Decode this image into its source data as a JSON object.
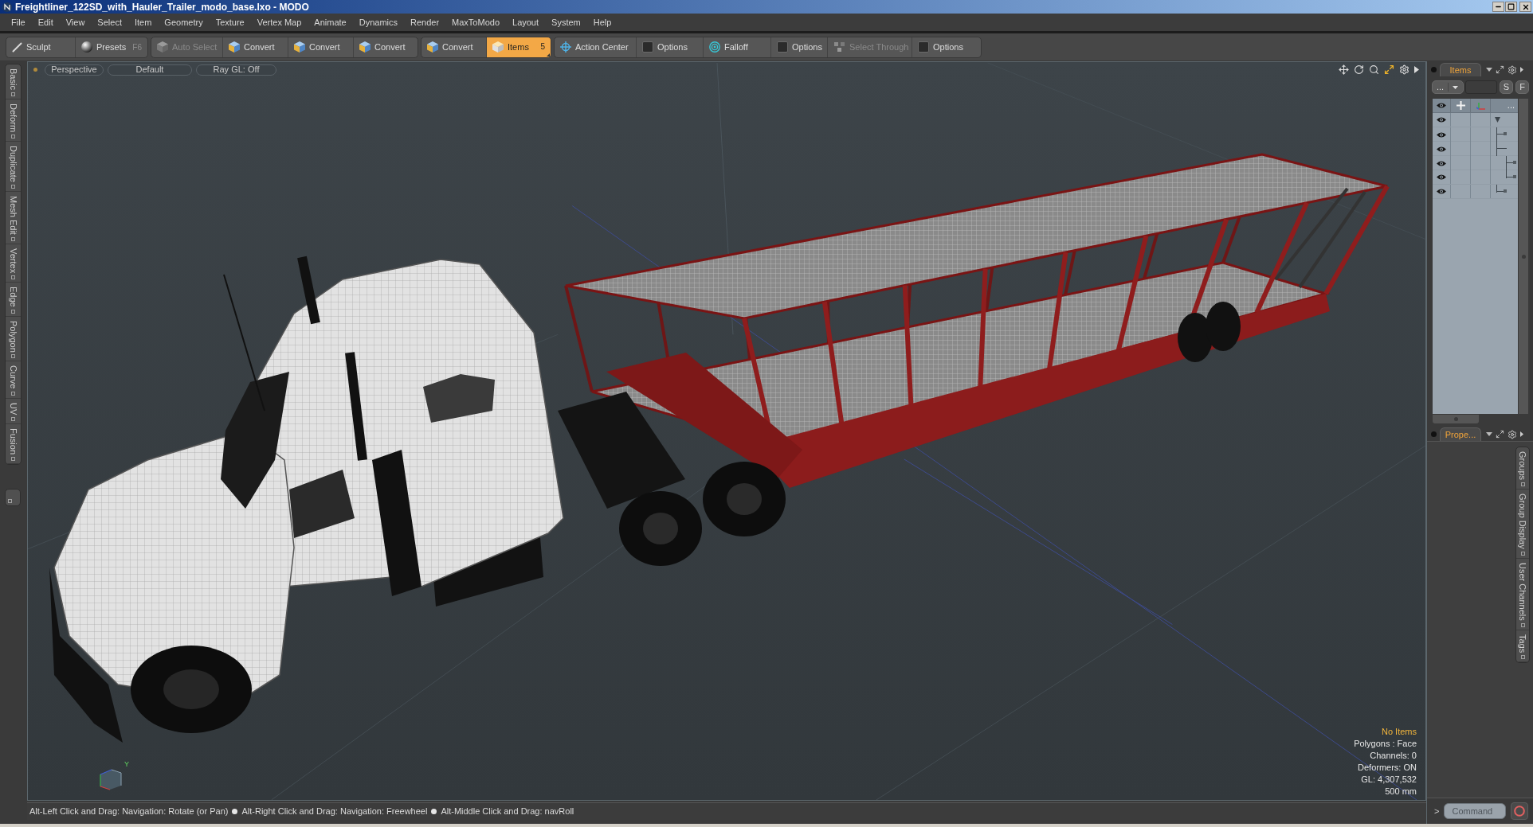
{
  "window": {
    "title": "Freightliner_122SD_with_Hauler_Trailer_modo_base.lxo - MODO"
  },
  "menu": [
    "File",
    "Edit",
    "View",
    "Select",
    "Item",
    "Geometry",
    "Texture",
    "Vertex Map",
    "Animate",
    "Dynamics",
    "Render",
    "MaxToModo",
    "Layout",
    "System",
    "Help"
  ],
  "toolbar": {
    "groups": [
      {
        "items": [
          {
            "kind": "sculpt",
            "label": "Sculpt",
            "selected": false,
            "disabled": false
          },
          {
            "kind": "presets",
            "label": "Presets",
            "shortcut": "F6",
            "selected": false,
            "disabled": false
          }
        ]
      },
      {
        "items": [
          {
            "kind": "select",
            "label": "Auto Select",
            "selected": false,
            "disabled": true
          },
          {
            "kind": "convert",
            "label": "Convert",
            "selected": false,
            "disabled": false
          },
          {
            "kind": "convert",
            "label": "Convert",
            "selected": false,
            "disabled": false
          },
          {
            "kind": "convert",
            "label": "Convert",
            "selected": false,
            "disabled": false
          }
        ]
      },
      {
        "items": [
          {
            "kind": "convert",
            "label": "Convert",
            "selected": false,
            "disabled": false
          },
          {
            "kind": "items",
            "label": "Items",
            "badge": "5",
            "selected": true,
            "disabled": false
          }
        ]
      },
      {
        "items": [
          {
            "kind": "center",
            "label": "Action Center",
            "selected": false,
            "disabled": false
          },
          {
            "kind": "option",
            "label": "Options",
            "checked": false,
            "selected": false,
            "disabled": false
          },
          {
            "kind": "falloff",
            "label": "Falloff",
            "selected": false,
            "disabled": false
          },
          {
            "kind": "option",
            "label": "Options",
            "checked": false,
            "selected": false,
            "disabled": false
          },
          {
            "kind": "through",
            "label": "Select Through",
            "selected": false,
            "disabled": true
          },
          {
            "kind": "option",
            "label": "Options",
            "checked": false,
            "selected": false,
            "disabled": false
          }
        ]
      }
    ]
  },
  "left_tabs": [
    "Basic",
    "Deform",
    "Duplicate",
    "Mesh Edit",
    "Vertex",
    "Edge",
    "Polygon",
    "Curve",
    "UV",
    "Fusion"
  ],
  "viewport": {
    "view_buttons": [
      "Perspective",
      "Default",
      "Ray GL: Off"
    ],
    "axis_label": "Y",
    "info": {
      "title": "No Items",
      "lines": [
        "Polygons : Face",
        "Channels: 0",
        "Deformers: ON",
        "GL: 4,307,532",
        "500 mm"
      ]
    }
  },
  "status_bar": {
    "hints": [
      "Alt-Left Click and Drag: Navigation: Rotate (or Pan)",
      "Alt-Right Click and Drag: Navigation: Freewheel",
      "Alt-Middle Click and Drag: navRoll"
    ]
  },
  "items_panel": {
    "tab": "Items",
    "filter_button": "...",
    "buttons": [
      "S",
      "F"
    ],
    "header_more": "...",
    "rows": [
      {
        "visible": true,
        "expanded": true,
        "children": [
          {
            "visible": true
          },
          {
            "visible": true,
            "children": [
              {
                "visible": true
              },
              {
                "visible": true
              }
            ]
          },
          {
            "visible": true
          }
        ]
      }
    ]
  },
  "properties_panel": {
    "tab": "Prope...",
    "side_tabs": [
      "Groups",
      "Group Display",
      "User Channels",
      "Tags"
    ]
  },
  "command": {
    "prompt": ">",
    "placeholder": "Command"
  }
}
